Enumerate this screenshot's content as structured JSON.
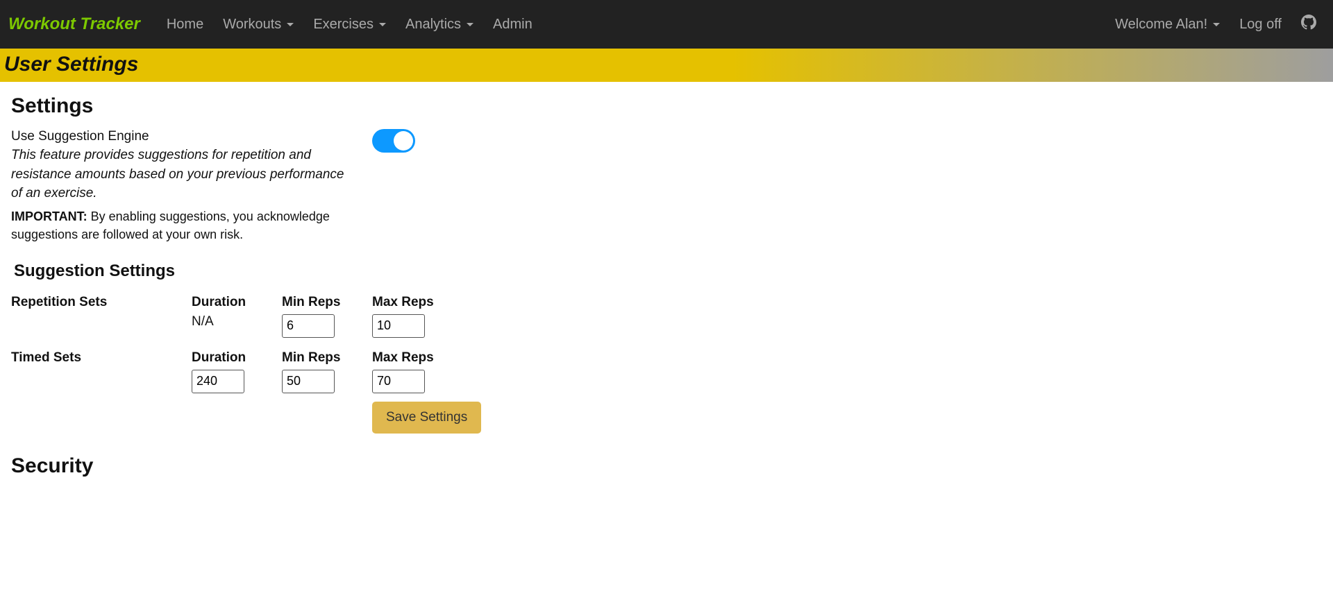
{
  "brand": "Workout Tracker",
  "nav": {
    "home": "Home",
    "workouts": "Workouts",
    "exercises": "Exercises",
    "analytics": "Analytics",
    "admin": "Admin",
    "welcome": "Welcome Alan!",
    "logoff": "Log off"
  },
  "header": {
    "title": "User Settings"
  },
  "settings": {
    "heading": "Settings",
    "suggestion_label": "Use Suggestion Engine",
    "suggestion_desc": "This feature provides suggestions for repetition and resistance amounts based on your previous performance of an exercise.",
    "important_label": "IMPORTANT:",
    "important_text": " By enabling suggestions, you acknowledge suggestions are followed at your own risk.",
    "toggle_on": true
  },
  "suggestion_settings": {
    "heading": "Suggestion Settings",
    "columns": {
      "row_label": "",
      "duration": "Duration",
      "min_reps": "Min Reps",
      "max_reps": "Max Reps"
    },
    "rows": [
      {
        "label": "Repetition Sets",
        "duration": "N/A",
        "duration_editable": false,
        "min_reps": "6",
        "max_reps": "10"
      },
      {
        "label": "Timed Sets",
        "duration": "240",
        "duration_editable": true,
        "min_reps": "50",
        "max_reps": "70"
      }
    ],
    "save_label": "Save Settings"
  },
  "security": {
    "heading": "Security"
  }
}
